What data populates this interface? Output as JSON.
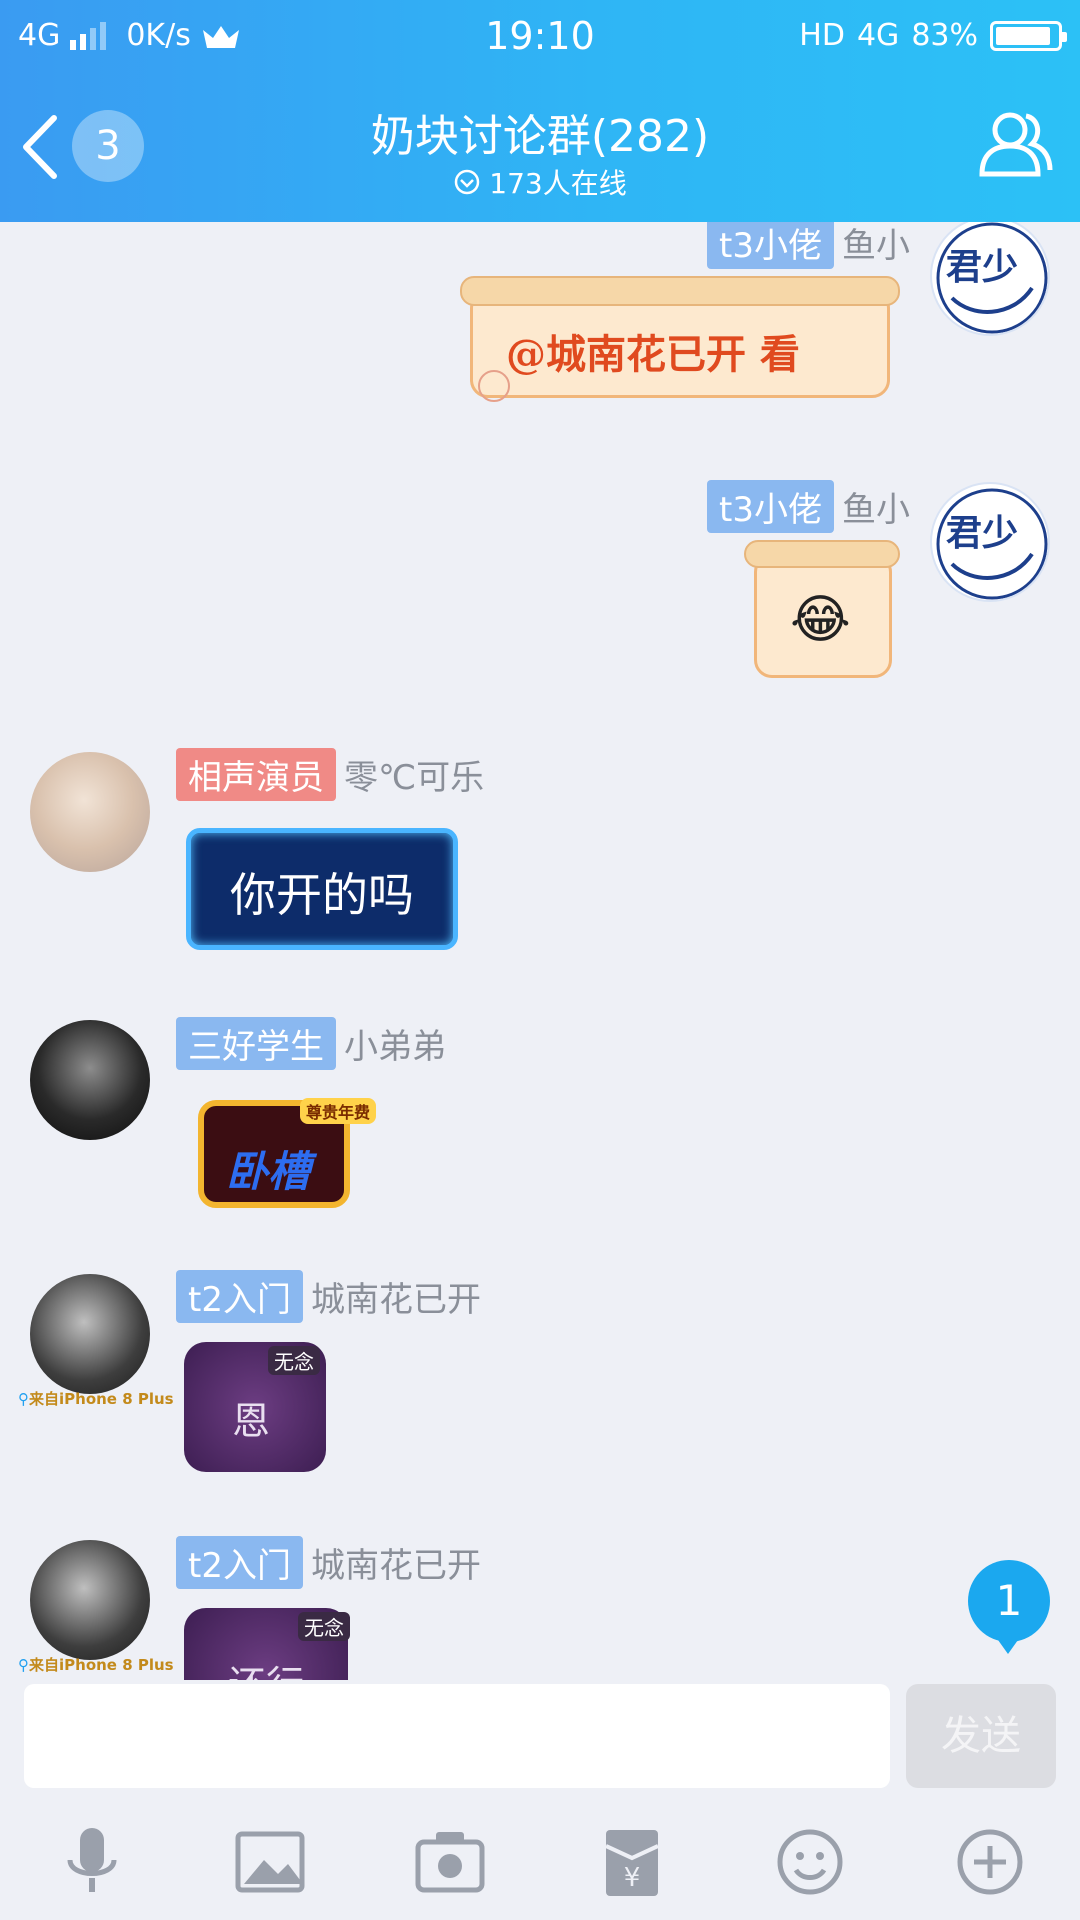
{
  "status_bar": {
    "network": "4G",
    "speed": "0K/s",
    "time": "19:10",
    "hd": "HD",
    "network_right": "4G",
    "battery": "83%"
  },
  "header": {
    "unread_count": "3",
    "title": "奶块讨论群(282)",
    "online": "173人在线"
  },
  "messages": [
    {
      "tag": "t3小佬",
      "name": "鱼小",
      "content": "@城南花已开 看",
      "avatar_text": "君少"
    },
    {
      "tag": "t3小佬",
      "name": "鱼小",
      "content": "😂",
      "avatar_text": "君少"
    },
    {
      "tag": "相声演员",
      "name": "零℃可乐",
      "content": "你开的吗"
    },
    {
      "tag": "三好学生",
      "name": "小弟弟",
      "content": "卧槽",
      "badge": "尊贵年费"
    },
    {
      "tag": "t2入门",
      "name": "城南花已开",
      "content": "恩",
      "badge": "无念",
      "from": "来自iPhone 8 Plus"
    },
    {
      "tag": "t2入门",
      "name": "城南花已开",
      "content": "还行",
      "badge": "无念",
      "from": "来自iPhone 8 Plus"
    }
  ],
  "fab_count": "1",
  "input": {
    "send_label": "发送"
  },
  "colors": {
    "header_start": "#3a9bf2",
    "header_end": "#2cc1f6",
    "tag_blue": "#8ab8f0",
    "tag_red": "#f08a86"
  }
}
